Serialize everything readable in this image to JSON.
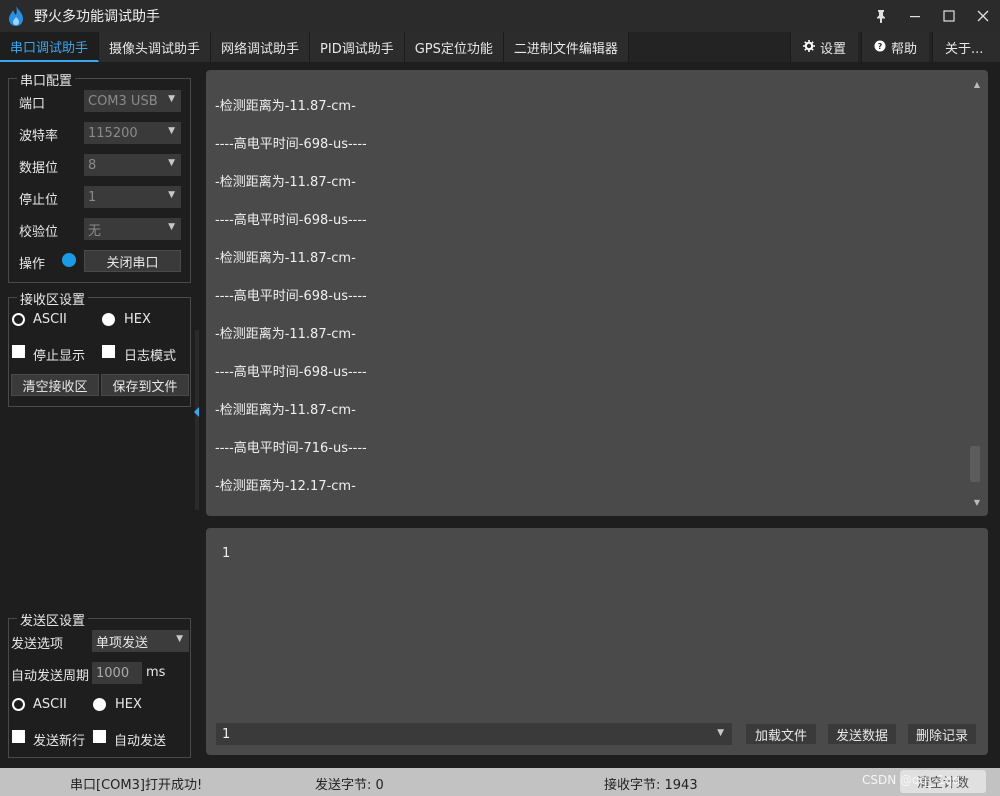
{
  "window": {
    "title": "野火多功能调试助手",
    "pin_icon": "pin-icon",
    "minimize_icon": "minimize-icon",
    "maximize_icon": "maximize-icon",
    "close_icon": "close-icon"
  },
  "tabs": [
    {
      "label": "串口调试助手",
      "active": true
    },
    {
      "label": "摄像头调试助手"
    },
    {
      "label": "网络调试助手"
    },
    {
      "label": "PID调试助手"
    },
    {
      "label": "GPS定位功能"
    },
    {
      "label": "二进制文件编辑器"
    }
  ],
  "right_tabs": {
    "settings": "设置",
    "help": "帮助",
    "about": "关于..."
  },
  "serial_config": {
    "title": "串口配置",
    "port_label": "端口",
    "port_value": "COM3 USB",
    "baud_label": "波特率",
    "baud_value": "115200",
    "databits_label": "数据位",
    "databits_value": "8",
    "stopbits_label": "停止位",
    "stopbits_value": "1",
    "parity_label": "校验位",
    "parity_value": "无",
    "operate_label": "操作",
    "close_port_button": "关闭串口"
  },
  "receive_settings": {
    "title": "接收区设置",
    "ascii": "ASCII",
    "hex": "HEX",
    "stop_display": "停止显示",
    "log_mode": "日志模式",
    "clear_button": "清空接收区",
    "save_button": "保存到文件",
    "selected_encoding": "HEX"
  },
  "send_settings": {
    "title": "发送区设置",
    "option_label": "发送选项",
    "option_value": "单项发送",
    "period_label": "自动发送周期",
    "period_value": "1000",
    "period_unit": "ms",
    "ascii": "ASCII",
    "hex": "HEX",
    "selected_encoding": "HEX",
    "newline": "发送新行",
    "auto_send": "自动发送"
  },
  "receive_lines": [
    "-检测距离为-11.87-cm-",
    "----高电平时间-698-us----",
    "-检测距离为-11.87-cm-",
    "----高电平时间-698-us----",
    "-检测距离为-11.87-cm-",
    "----高电平时间-698-us----",
    "-检测距离为-11.87-cm-",
    "----高电平时间-698-us----",
    "-检测距离为-11.87-cm-",
    "----高电平时间-716-us----",
    "-检测距离为-12.17-cm-"
  ],
  "send_area": {
    "text": "1",
    "history_value": "1",
    "load_file_button": "加载文件",
    "send_button": "发送数据",
    "delete_button": "删除记录"
  },
  "status": {
    "message": "串口[COM3]打开成功!",
    "sent_bytes": "发送字节: 0",
    "received_bytes": "接收字节: 1943",
    "watermark": "CSDN @qq_ 1qq",
    "clear_count_button": "清空计数"
  },
  "colors": {
    "accent": "#3ba7f0",
    "led": "#1b9be6",
    "panel": "#4a4a4a",
    "background": "#1e1e1e"
  }
}
